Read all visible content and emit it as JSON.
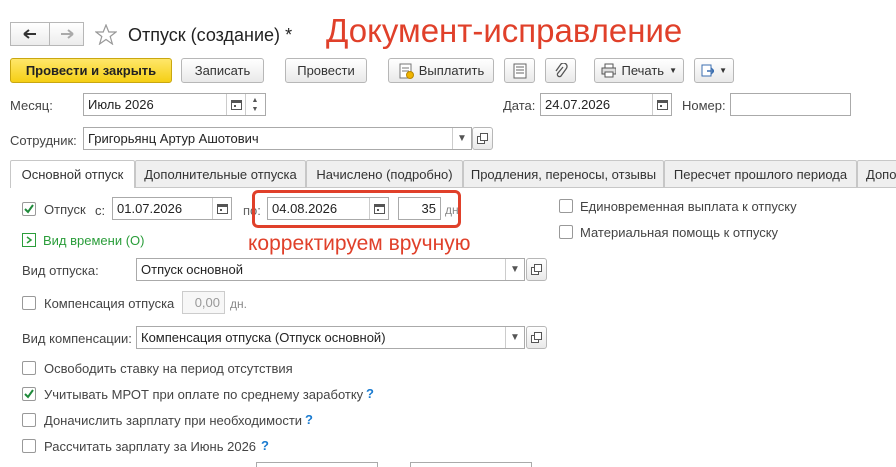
{
  "window": {
    "title": "Отпуск (создание)",
    "modified_mark": "*",
    "annotation_title": "Документ-исправление",
    "annotation_note": "корректируем вручную"
  },
  "toolbar": {
    "post_close_label": "Провести и закрыть",
    "save_label": "Записать",
    "post_label": "Провести",
    "pay_label": "Выплатить",
    "print_label": "Печать"
  },
  "header": {
    "month_label": "Месяц:",
    "month_value": "Июль 2026",
    "date_label": "Дата:",
    "date_value": "24.07.2026",
    "number_label": "Номер:",
    "number_value": "",
    "employee_label": "Сотрудник:",
    "employee_value": "Григорьянц Артур Ашотович"
  },
  "tabs": [
    {
      "label": "Основной отпуск",
      "active": true
    },
    {
      "label": "Дополнительные отпуска",
      "active": false
    },
    {
      "label": "Начислено (подробно)",
      "active": false
    },
    {
      "label": "Продления, переносы, отзывы",
      "active": false
    },
    {
      "label": "Пересчет прошлого периода",
      "active": false
    },
    {
      "label": "Допо",
      "active": false
    }
  ],
  "main": {
    "vacation_check_label": "Отпуск",
    "vacation_checked": true,
    "from_label": "с:",
    "from_value": "01.07.2026",
    "to_label": "по:",
    "to_value": "04.08.2026",
    "days_value": "35",
    "days_unit": "дн",
    "time_type_label": "Вид времени (О)",
    "vacation_type_label": "Вид отпуска:",
    "vacation_type_value": "Отпуск основной",
    "compensation_label": "Компенсация отпуска",
    "compensation_checked": false,
    "compensation_value": "0,00",
    "compensation_unit": "дн.",
    "comp_type_label": "Вид компенсации:",
    "comp_type_value": "Компенсация отпуска (Отпуск основной)",
    "release_rate_label": "Освободить ставку на период отсутствия",
    "release_rate_checked": false,
    "mrot_label": "Учитывать МРОТ при оплате по среднему заработку",
    "mrot_checked": true,
    "extra_salary_label": "Доначислить зарплату при необходимости",
    "extra_salary_checked": false,
    "calc_salary_label": "Рассчитать зарплату за Июнь 2026",
    "calc_salary_checked": false,
    "help_mark": "?"
  },
  "right_panel": {
    "lump_sum_label": "Единовременная выплата к отпуску",
    "lump_sum_checked": false,
    "material_aid_label": "Материальная помощь к отпуску",
    "material_aid_checked": false
  },
  "colors": {
    "primary_button": "#f5cf15",
    "annotation_red": "#e0402a",
    "time_type_green": "#2a9d3a",
    "help_blue": "#1a7bd0"
  }
}
